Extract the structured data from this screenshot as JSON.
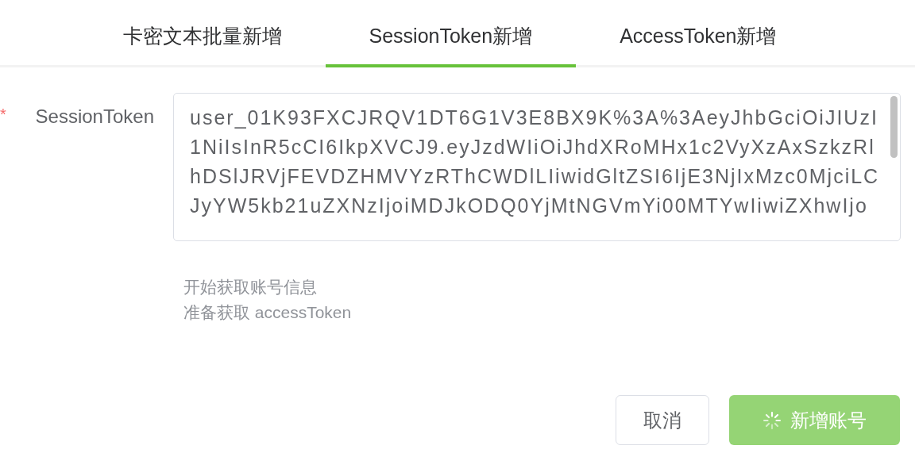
{
  "tabs": [
    {
      "label": "卡密文本批量新增",
      "selected": false
    },
    {
      "label": "SessionToken新增",
      "selected": true
    },
    {
      "label": "AccessToken新增",
      "selected": false
    }
  ],
  "form": {
    "label": "SessionToken",
    "required_mark": "*",
    "value_lines": [
      "user_01K93FXCJRQV1DT6G1V3E8BX9K%3A%3AeyJhbGciOiJIUzI",
      "1NiIsInR5cCI6IkpXVCJ9.eyJzdWIiOiJhdXRoMHx1c2VyXzAxSzkzRl",
      "hDSlJRVjFEVDZHMVYzRThCWDlLIiwidGltZSI6IjE3NjIxMzc0MjciLC",
      "JyYW5kb21uZXNzIjoiMDJkODQ0YjMtNGVmYi00MTYwIiwiZXhwIjo"
    ]
  },
  "log": [
    "开始获取账号信息",
    "准备获取 accessToken"
  ],
  "buttons": {
    "cancel": {
      "label": "取消"
    },
    "submit": {
      "label": "新增账号",
      "loading": true
    }
  }
}
